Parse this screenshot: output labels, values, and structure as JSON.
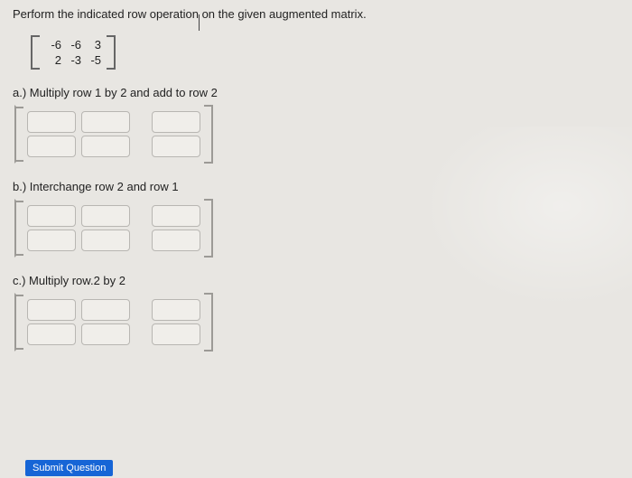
{
  "instruction_pre": "Perform the indicated row operation",
  "instruction_post": "on the given augmented matrix.",
  "given_matrix": {
    "rows": [
      {
        "c1": "-6",
        "c2": "-6",
        "c3": "3"
      },
      {
        "c1": "2",
        "c2": "-3",
        "c3": "-5"
      }
    ]
  },
  "parts": {
    "a": {
      "label": "a.) Multiply row 1 by 2 and add to row 2",
      "values": [
        [
          "",
          "",
          ""
        ],
        [
          "",
          "",
          ""
        ]
      ]
    },
    "b": {
      "label": "b.) Interchange row 2 and row 1",
      "values": [
        [
          "",
          "",
          ""
        ],
        [
          "",
          "",
          ""
        ]
      ]
    },
    "c": {
      "label": "c.) Multiply row.2 by 2",
      "values": [
        [
          "",
          "",
          ""
        ],
        [
          "",
          "",
          ""
        ]
      ]
    }
  },
  "submit_label": "Submit Question"
}
